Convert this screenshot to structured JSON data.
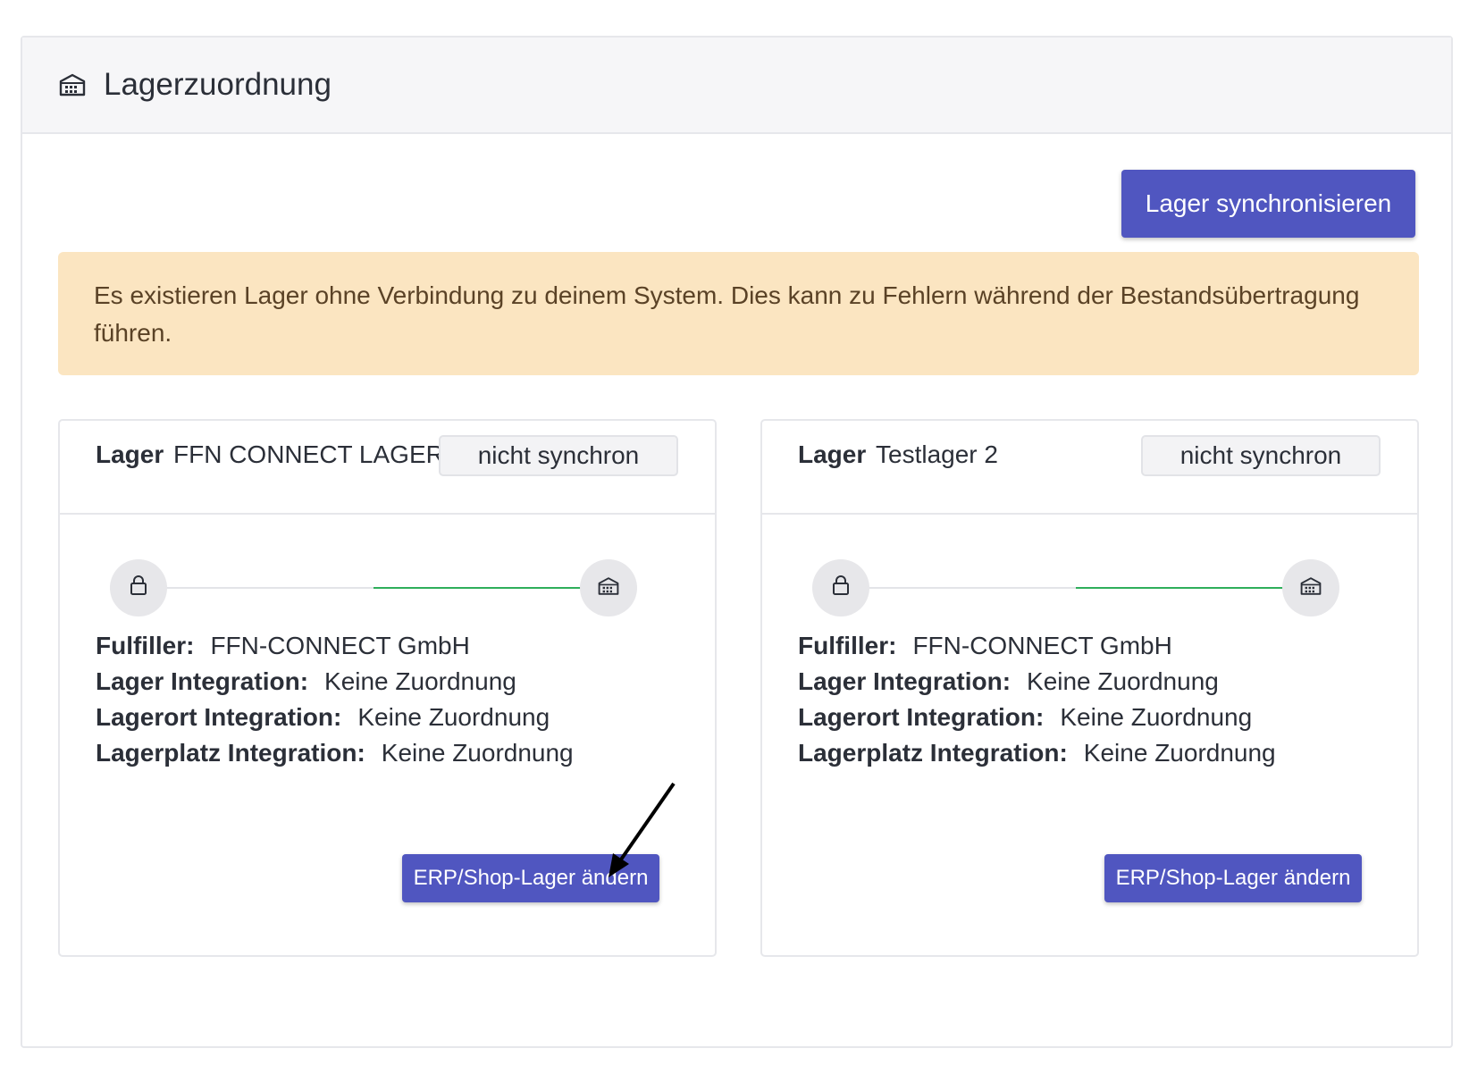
{
  "header": {
    "title": "Lagerzuordnung",
    "icon": "warehouse-icon"
  },
  "toolbar": {
    "sync_label": "Lager synchronisieren",
    "accent": "#5056c0"
  },
  "alert": {
    "text": "Es existieren Lager ohne Verbindung zu deinem System. Dies kann zu Fehlern während der Bestandsübertragung führen.",
    "background": "#fbe5c1"
  },
  "warehouses": [
    {
      "keyword": "Lager",
      "name": "FFN CONNECT LAGER",
      "status": "nicht synchron",
      "fields": [
        {
          "label": "Fulfiller:",
          "value": "FFN-CONNECT GmbH"
        },
        {
          "label": "Lager Integration:",
          "value": "Keine Zuordnung"
        },
        {
          "label": "Lagerort Integration:",
          "value": "Keine Zuordnung"
        },
        {
          "label": "Lagerplatz Integration:",
          "value": "Keine Zuordnung"
        }
      ],
      "action_label": "ERP/Shop-Lager ändern"
    },
    {
      "keyword": "Lager",
      "name": "Testlager 2",
      "status": "nicht synchron",
      "fields": [
        {
          "label": "Fulfiller:",
          "value": "FFN-CONNECT GmbH"
        },
        {
          "label": "Lager Integration:",
          "value": "Keine Zuordnung"
        },
        {
          "label": "Lagerort Integration:",
          "value": "Keine Zuordnung"
        },
        {
          "label": "Lagerplatz Integration:",
          "value": "Keine Zuordnung"
        }
      ],
      "action_label": "ERP/Shop-Lager ändern"
    }
  ],
  "icons": {
    "shop": "shopping-bag-icon",
    "warehouse": "warehouse-icon"
  },
  "colors": {
    "connection_line": "#2fae5b"
  }
}
